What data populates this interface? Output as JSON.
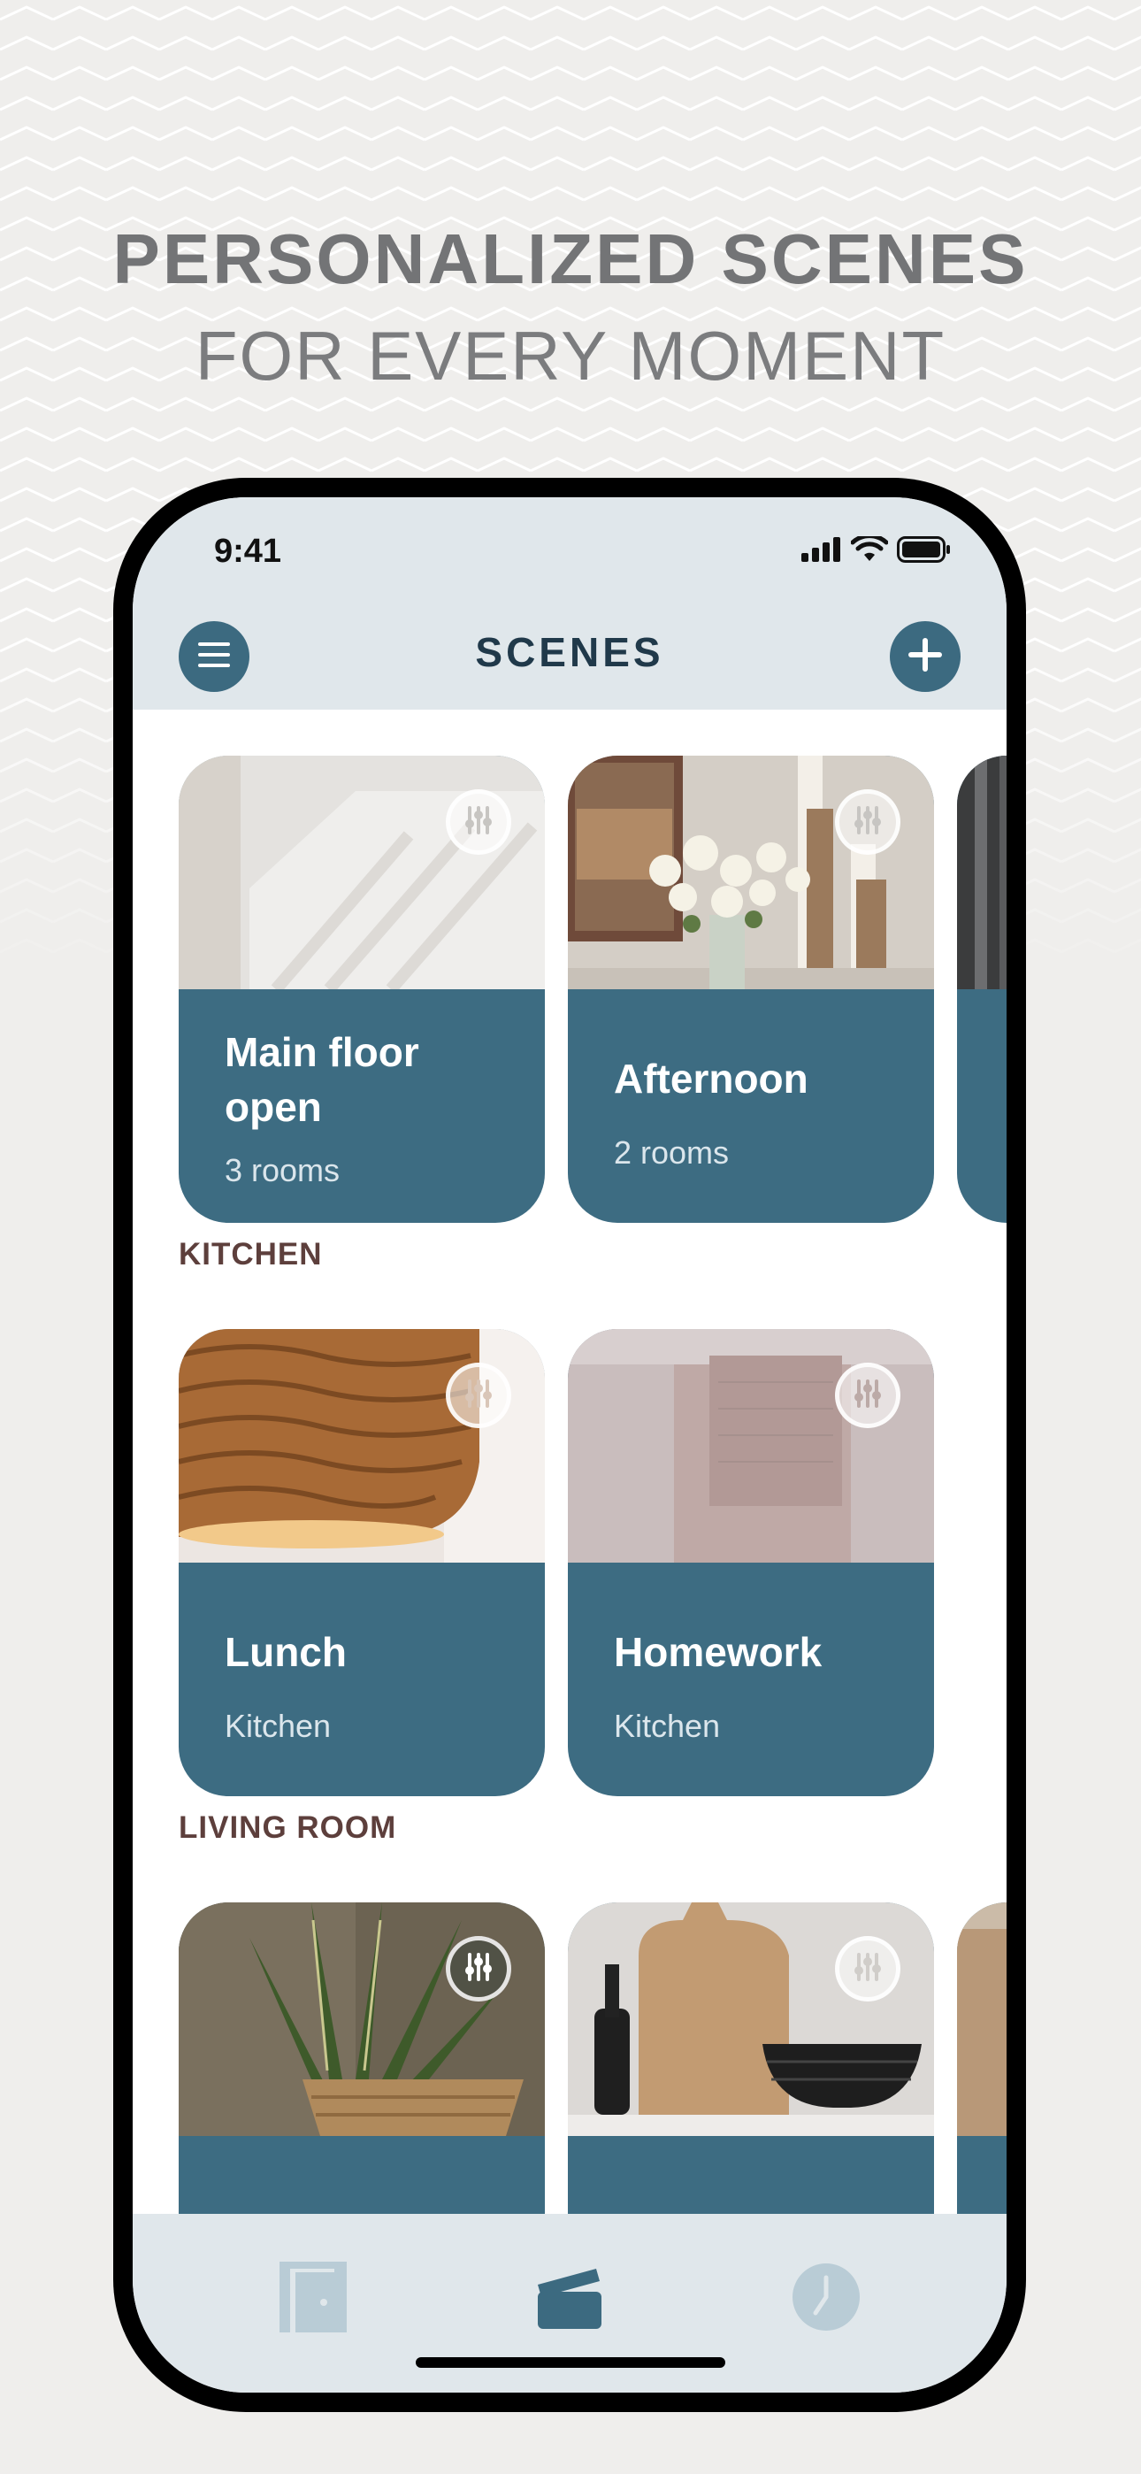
{
  "headline": {
    "line1": "PERSONALIZED SCENES",
    "line2": "FOR EVERY MOMENT"
  },
  "status_bar": {
    "time": "9:41",
    "icons": [
      "cellular-signal-icon",
      "wifi-icon",
      "battery-icon"
    ]
  },
  "header": {
    "title": "SCENES",
    "menu_icon": "hamburger-menu-icon",
    "add_icon": "plus-icon"
  },
  "featured": [
    {
      "title": "Main floor open",
      "subtitle": "3 rooms"
    },
    {
      "title": "Afternoon",
      "subtitle": "2 rooms"
    }
  ],
  "sections": [
    {
      "label": "KITCHEN",
      "cards": [
        {
          "title": "Lunch",
          "subtitle": "Kitchen"
        },
        {
          "title": "Homework",
          "subtitle": "Kitchen"
        }
      ]
    },
    {
      "label": "LIVING ROOM",
      "cards": []
    }
  ],
  "tabbar": {
    "items": [
      "door-icon",
      "scenes-icon",
      "clock-icon"
    ],
    "active": "scenes-icon"
  },
  "colors": {
    "accent": "#3c6a80",
    "card": "#3d6c82",
    "header_bg": "#e0e7eb",
    "section_label": "#5d3f3c",
    "headline": "#737476"
  }
}
